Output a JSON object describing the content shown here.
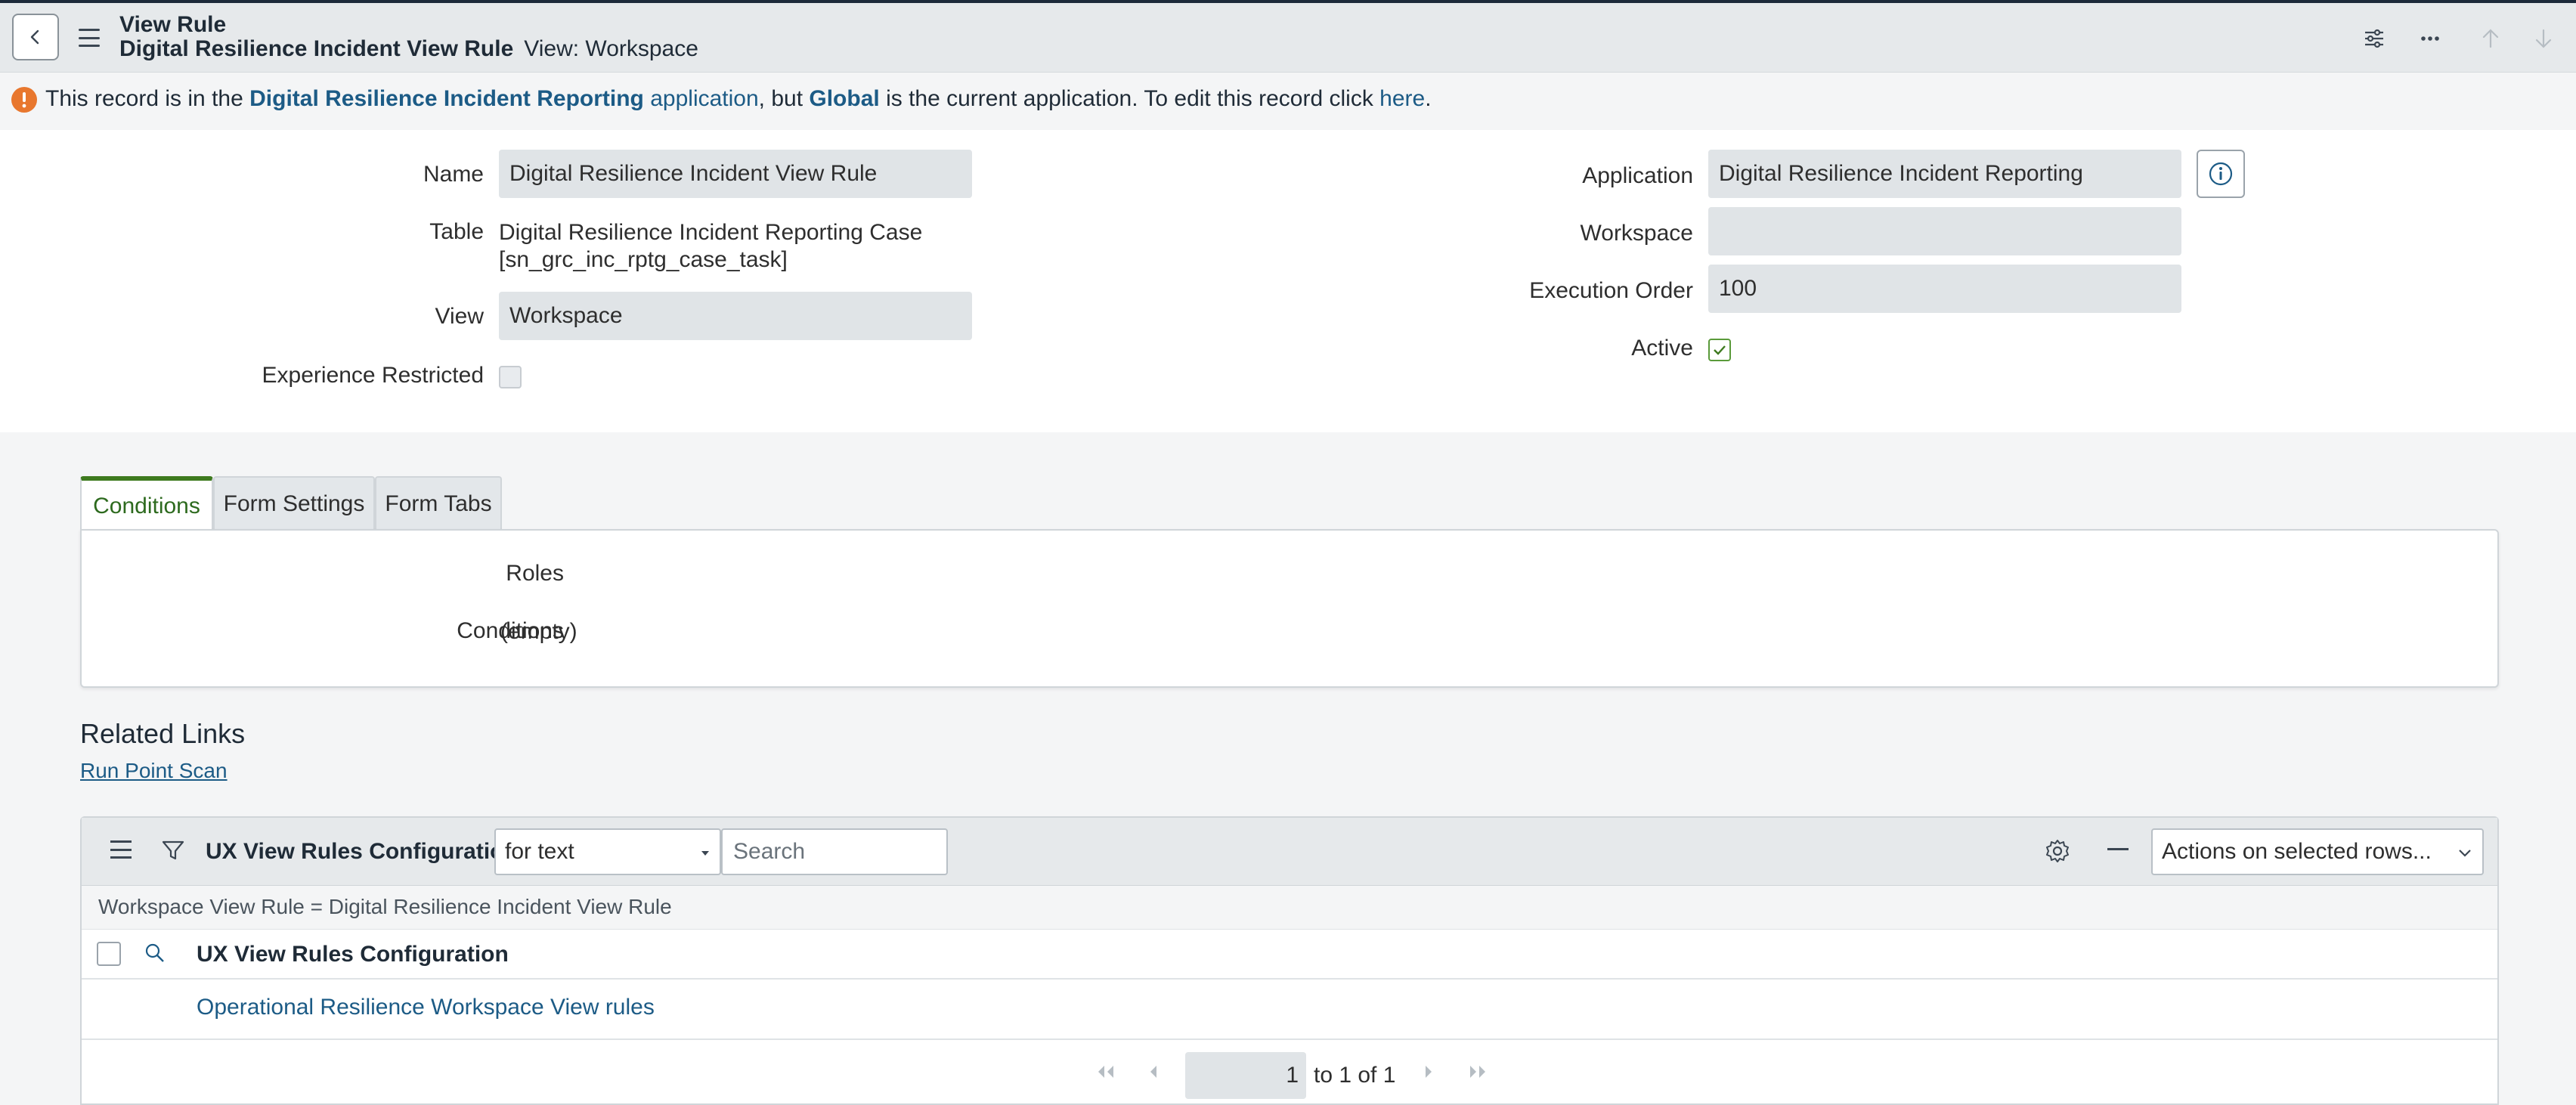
{
  "header": {
    "title": "View Rule",
    "record_name": "Digital Resilience Incident View Rule",
    "view_label": "View: Workspace"
  },
  "warning": {
    "prefix": "This record is in the",
    "app_name": "Digital Resilience Incident Reporting",
    "app_link": "application",
    "middle": ", but",
    "current_app": "Global",
    "suffix": "is the current application. To edit this record click",
    "here_link": "here",
    "end": "."
  },
  "form": {
    "name_label": "Name",
    "name_value": "Digital Resilience Incident View Rule",
    "table_label": "Table",
    "table_value_line1": "Digital Resilience Incident Reporting Case",
    "table_value_line2": "[sn_grc_inc_rptg_case_task]",
    "view_label": "View",
    "view_value": "Workspace",
    "experience_label": "Experience Restricted",
    "experience_checked": false,
    "application_label": "Application",
    "application_value": "Digital Resilience Incident Reporting",
    "workspace_label": "Workspace",
    "workspace_value": "",
    "execution_label": "Execution Order",
    "execution_value": "100",
    "active_label": "Active",
    "active_checked": true
  },
  "tabs": [
    {
      "label": "Conditions",
      "active": true
    },
    {
      "label": "Form Settings",
      "active": false
    },
    {
      "label": "Form Tabs",
      "active": false
    }
  ],
  "conditions_panel": {
    "roles_label": "Roles",
    "roles_value": "",
    "conditions_label": "Conditions",
    "conditions_value": "(empty)"
  },
  "related_links": {
    "title": "Related Links",
    "link": "Run Point Scan"
  },
  "related_list": {
    "title": "UX View Rules Configurations",
    "search_type": "for text",
    "search_placeholder": "Search",
    "actions_label": "Actions on selected rows...",
    "filter_text": "Workspace View Rule = Digital Resilience Incident View Rule",
    "column_header": "UX View Rules Configuration",
    "rows": [
      "Operational Resilience Workspace View rules"
    ],
    "page_value": "1",
    "page_text": "to 1 of 1"
  },
  "colors": {
    "link": "#1c5b86",
    "active_tab": "#3e7a1f",
    "warning_icon": "#e8772e"
  }
}
